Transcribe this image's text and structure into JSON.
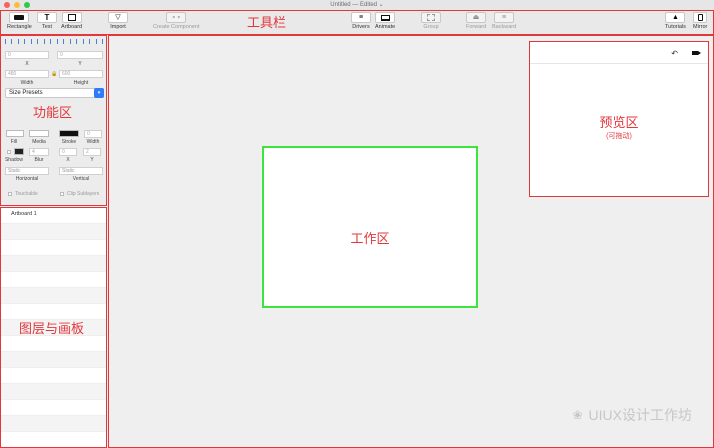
{
  "window": {
    "title": "Untitled — Edited ⌄"
  },
  "toolbar": {
    "section_label": "工具栏",
    "items": {
      "rectangle": "Rectangle",
      "text": "Text",
      "artboard": "Artboard",
      "import": "Import",
      "create_component": "Create Component",
      "drivers": "Drivers",
      "animate": "Animate",
      "group": "Group",
      "forward": "Forward",
      "backward": "Backward",
      "tutorials": "Tutorials",
      "mirror": "Mirror"
    }
  },
  "properties": {
    "section_label": "功能区",
    "x_value": "0",
    "y_value": "0",
    "x_label": "X",
    "y_label": "Y",
    "width_value": "480",
    "height_value": "600",
    "width_label": "Width",
    "height_label": "Height",
    "size_presets": "Size Presets",
    "fill_label": "Fill",
    "media_label": "Media",
    "stroke_label": "Stroke",
    "stroke_width_label": "Width",
    "stroke_width_value": "0",
    "shadow_label": "Shadow",
    "blur_label": "Blur",
    "blur_value": "4",
    "shadow_x_value": "0",
    "shadow_y_value": "2",
    "shadow_x_label": "X",
    "shadow_y_label": "Y",
    "horizontal_value": "Static",
    "vertical_value": "Static",
    "horizontal_label": "Horizontal",
    "vertical_label": "Vertical",
    "touchable_label": "Touchable",
    "clip_sublayers_label": "Clip Sublayers"
  },
  "layers": {
    "section_label": "图层与画板",
    "items": [
      "Artboard 1",
      "",
      "",
      "",
      "",
      "",
      "",
      "",
      "",
      "",
      "",
      "",
      "",
      "",
      ""
    ]
  },
  "workspace": {
    "section_label": "工作区"
  },
  "preview": {
    "section_label": "预览区",
    "sub_label": "(可拖动)"
  },
  "watermark": {
    "text": "UIUX设计工作坊"
  },
  "colors": {
    "annotation_red": "#e2373b",
    "artboard_border": "#3ee33c",
    "accent_blue": "#2f7cf6"
  }
}
